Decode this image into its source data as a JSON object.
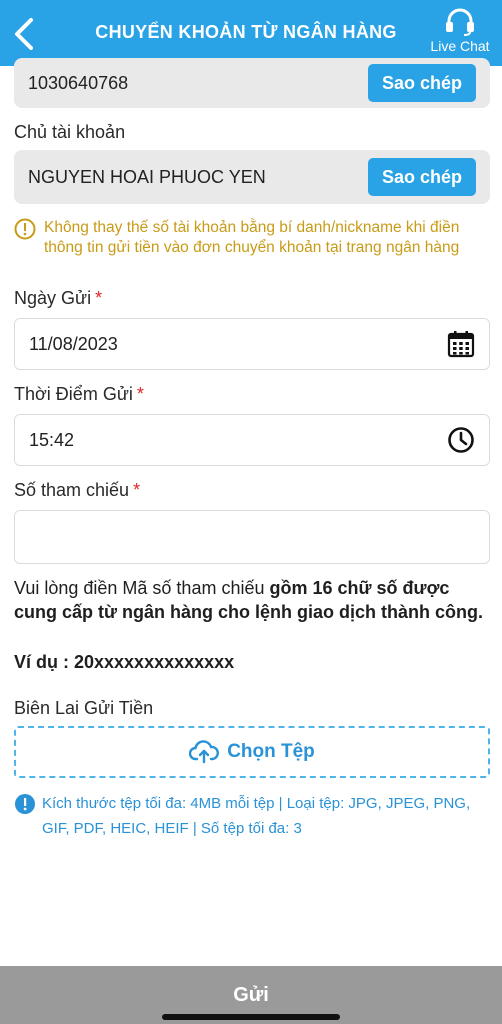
{
  "header": {
    "title": "CHUYỂN KHOẢN TỪ NGÂN HÀNG",
    "live_chat_label": "Live Chat",
    "background": "#2aa2e6"
  },
  "account_number": {
    "value": "1030640768",
    "copy_label": "Sao chép"
  },
  "account_holder": {
    "label": "Chủ tài khoản",
    "value": "NGUYEN HOAI PHUOC YEN",
    "copy_label": "Sao chép"
  },
  "warning": {
    "text": "Không thay thế số tài khoản bằng bí danh/nickname khi điền thông tin gửi tiền vào đơn chuyển khoản tại trang ngân hàng",
    "color": "#c89b17"
  },
  "deposit_date": {
    "label": "Ngày Gửi",
    "required_mark": "*",
    "value": "11/08/2023",
    "icon": "calendar-icon"
  },
  "deposit_time": {
    "label": "Thời Điểm Gửi",
    "required_mark": "*",
    "value": "15:42",
    "icon": "clock-icon"
  },
  "reference": {
    "label": "Số tham chiếu",
    "required_mark": "*",
    "value": "",
    "note_prefix": "Vui lòng điền Mã số tham chiếu ",
    "note_bold": "gồm 16 chữ số được cung cấp từ ngân hàng cho lệnh giao dịch thành công.",
    "example": "Ví dụ : 20xxxxxxxxxxxxxx"
  },
  "receipt": {
    "label": "Biên Lai Gửi Tiền",
    "upload_label": "Chọn Tệp",
    "info": "Kích thước tệp tối đa: 4MB mỗi tệp | Loại tệp: JPG, JPEG, PNG, GIF, PDF, HEIC, HEIF | Số tệp tối đa: 3"
  },
  "footer": {
    "submit_label": "Gửi",
    "background": "#9a9a9a"
  }
}
